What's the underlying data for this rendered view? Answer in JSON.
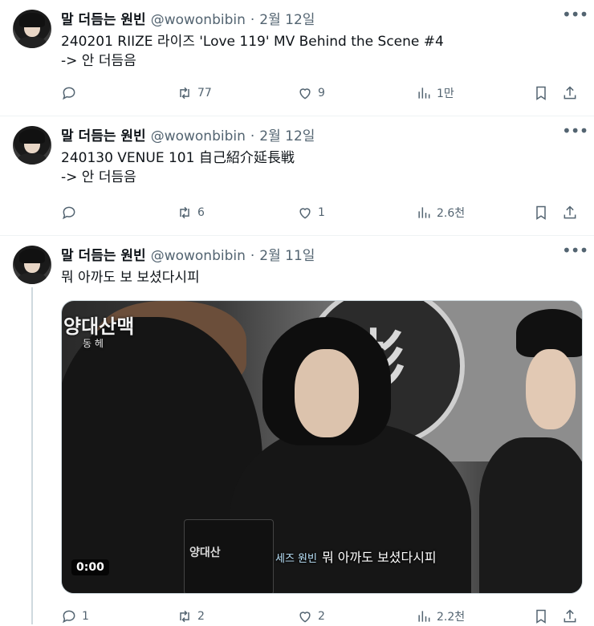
{
  "tweets": [
    {
      "author": "말 더듬는 원빈",
      "handle": "@wowonbibin",
      "separator": "·",
      "date": "2월 12일",
      "lines": [
        "240201 RIIZE 라이즈 'Love 119' MV Behind the Scene #4",
        "-> 안 더듬음"
      ],
      "stats": {
        "replies": "",
        "retweets": "77",
        "likes": "9",
        "views": "1만"
      }
    },
    {
      "author": "말 더듬는 원빈",
      "handle": "@wowonbibin",
      "separator": "·",
      "date": "2월 12일",
      "lines": [
        "240130 VENUE 101 自己紹介延長戦",
        "-> 안 더듬음"
      ],
      "stats": {
        "replies": "",
        "retweets": "6",
        "likes": "1",
        "views": "2.6천"
      }
    },
    {
      "author": "말 더듬는 원빈",
      "handle": "@wowonbibin",
      "separator": "·",
      "date": "2월 11일",
      "lines": [
        "뭐 아까도 보 보셨다시피"
      ],
      "media": {
        "duration": "0:00",
        "subtitle_tag": "세즈 원빈",
        "subtitle": "뭐 아까도 보셨다시피",
        "overlay_logo": "양대산맥",
        "overlay_sub": "동 헤",
        "book_title": "양대산",
        "sign_glyph": "彬"
      },
      "stats": {
        "replies": "1",
        "retweets": "2",
        "likes": "2",
        "views": "2.2천"
      }
    }
  ],
  "icons": {
    "more": "more-horizontal-icon",
    "reply": "reply-bubble-icon",
    "retweet": "retweet-icon",
    "like": "heart-icon",
    "views": "bar-chart-icon",
    "bookmark": "bookmark-icon",
    "share": "share-upload-icon"
  },
  "colors": {
    "text": "#0f1419",
    "secondary": "#536471",
    "border": "#eff3f4",
    "thread_line": "#cfd9de"
  }
}
